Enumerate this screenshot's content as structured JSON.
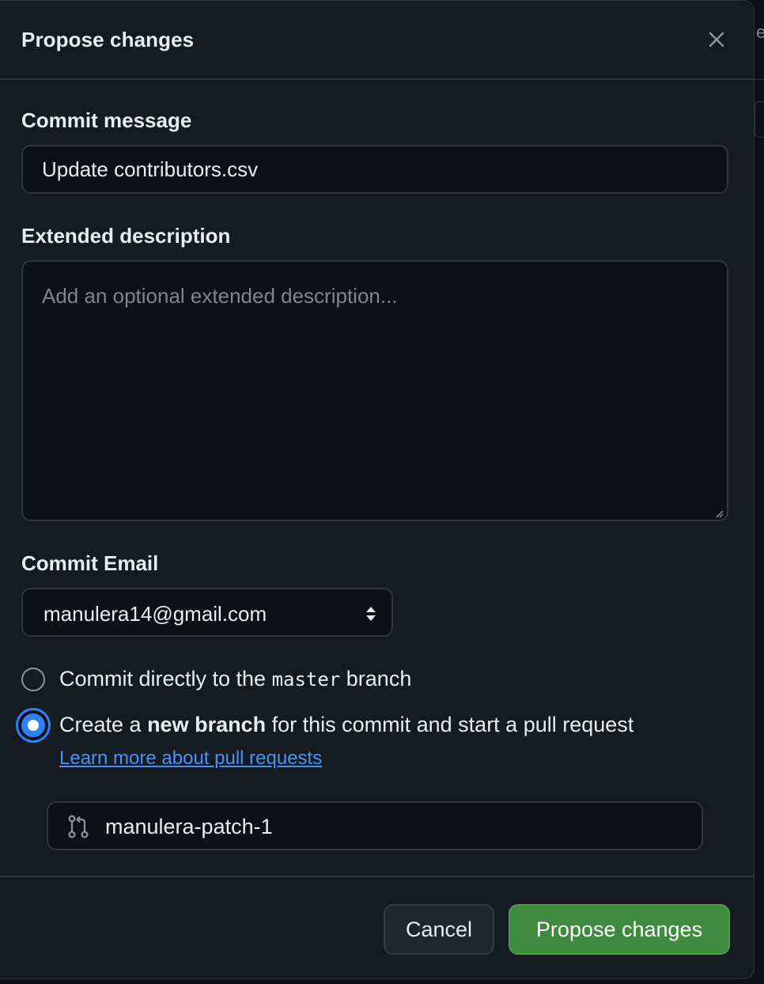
{
  "dialog": {
    "title": "Propose changes",
    "close_icon": "close-icon"
  },
  "commit_message": {
    "label": "Commit message",
    "value": "Update contributors.csv"
  },
  "extended_description": {
    "label": "Extended description",
    "placeholder": "Add an optional extended description...",
    "value": ""
  },
  "commit_email": {
    "label": "Commit Email",
    "selected": "manulera14@gmail.com",
    "icon": "select-arrows-icon"
  },
  "branch_options": {
    "direct": {
      "prefix": "Commit directly to the ",
      "branch": "master",
      "suffix": " branch",
      "checked": false
    },
    "new_branch": {
      "prefix": "Create a ",
      "bold": "new branch",
      "suffix": " for this commit and start a pull request",
      "checked": true
    },
    "learn_more_link": "Learn more about pull requests"
  },
  "new_branch_name": {
    "value": "manulera-patch-1",
    "icon": "git-pull-request-icon"
  },
  "footer": {
    "cancel_label": "Cancel",
    "propose_label": "Propose changes"
  },
  "colors": {
    "background": "#161b22",
    "input_bg": "#0d1117",
    "border": "#30363d",
    "accent_blue": "#2f81f7",
    "link": "#4493f8",
    "primary_button": "#3e8a3e"
  }
}
